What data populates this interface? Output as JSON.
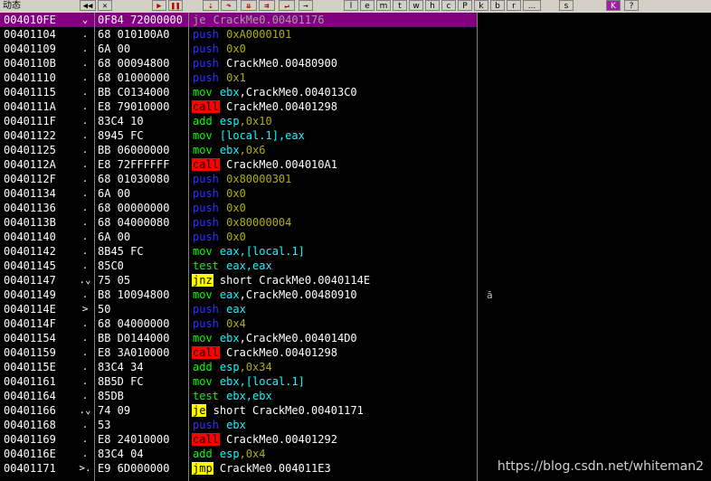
{
  "toolbar": {
    "state_label": "动态",
    "letters": [
      "l",
      "e",
      "m",
      "t",
      "w",
      "h",
      "c",
      "P",
      "k",
      "b",
      "r",
      "...",
      "s"
    ],
    "k_label": "K"
  },
  "right_marker": "ā",
  "watermark": "https://blog.csdn.net/whiteman2",
  "rows": [
    {
      "addr": "004010FE",
      "mark": "⌄",
      "hex": "0F84 72000000",
      "asm": [
        {
          "t": "mn",
          "k": "jcc",
          "v": "je"
        },
        {
          "t": "text",
          "v": " CrackMe0.00401176"
        }
      ],
      "selected": true
    },
    {
      "addr": "00401104",
      "mark": ".",
      "hex": "68 010100A0",
      "asm": [
        {
          "t": "mn",
          "k": "push",
          "v": "push"
        },
        {
          "t": "num",
          "v": " 0xA0000101"
        }
      ]
    },
    {
      "addr": "00401109",
      "mark": ".",
      "hex": "6A 00",
      "asm": [
        {
          "t": "mn",
          "k": "push",
          "v": "push"
        },
        {
          "t": "num",
          "v": " 0x0"
        }
      ]
    },
    {
      "addr": "0040110B",
      "mark": ".",
      "hex": "68 00094800",
      "asm": [
        {
          "t": "mn",
          "k": "push",
          "v": "push"
        },
        {
          "t": "text",
          "v": " CrackMe0.00480900"
        }
      ]
    },
    {
      "addr": "00401110",
      "mark": ".",
      "hex": "68 01000000",
      "asm": [
        {
          "t": "mn",
          "k": "push",
          "v": "push"
        },
        {
          "t": "num",
          "v": " 0x1"
        }
      ]
    },
    {
      "addr": "00401115",
      "mark": ".",
      "hex": "BB C0134000",
      "asm": [
        {
          "t": "mn",
          "k": "mov",
          "v": "mov"
        },
        {
          "t": "reg",
          "v": " ebx"
        },
        {
          "t": "text",
          "v": ",CrackMe0.004013C0"
        }
      ]
    },
    {
      "addr": "0040111A",
      "mark": ".",
      "hex": "E8 79010000",
      "asm": [
        {
          "t": "mn",
          "k": "call",
          "v": "call"
        },
        {
          "t": "text",
          "v": " CrackMe0.00401298"
        }
      ]
    },
    {
      "addr": "0040111F",
      "mark": ".",
      "hex": "83C4 10",
      "asm": [
        {
          "t": "mn",
          "k": "add",
          "v": "add"
        },
        {
          "t": "reg",
          "v": " esp"
        },
        {
          "t": "num",
          "v": ",0x10"
        }
      ]
    },
    {
      "addr": "00401122",
      "mark": ".",
      "hex": "8945 FC",
      "asm": [
        {
          "t": "mn",
          "k": "mov",
          "v": "mov"
        },
        {
          "t": "mem",
          "v": " [local.1]"
        },
        {
          "t": "reg",
          "v": ",eax"
        }
      ]
    },
    {
      "addr": "00401125",
      "mark": ".",
      "hex": "BB 06000000",
      "asm": [
        {
          "t": "mn",
          "k": "mov",
          "v": "mov"
        },
        {
          "t": "reg",
          "v": " ebx"
        },
        {
          "t": "num",
          "v": ",0x6"
        }
      ]
    },
    {
      "addr": "0040112A",
      "mark": ".",
      "hex": "E8 72FFFFFF",
      "asm": [
        {
          "t": "mn",
          "k": "call",
          "v": "call"
        },
        {
          "t": "text",
          "v": " CrackMe0.004010A1"
        }
      ]
    },
    {
      "addr": "0040112F",
      "mark": ".",
      "hex": "68 01030080",
      "asm": [
        {
          "t": "mn",
          "k": "push",
          "v": "push"
        },
        {
          "t": "num",
          "v": " 0x80000301"
        }
      ]
    },
    {
      "addr": "00401134",
      "mark": ".",
      "hex": "6A 00",
      "asm": [
        {
          "t": "mn",
          "k": "push",
          "v": "push"
        },
        {
          "t": "num",
          "v": " 0x0"
        }
      ]
    },
    {
      "addr": "00401136",
      "mark": ".",
      "hex": "68 00000000",
      "asm": [
        {
          "t": "mn",
          "k": "push",
          "v": "push"
        },
        {
          "t": "num",
          "v": " 0x0"
        }
      ]
    },
    {
      "addr": "0040113B",
      "mark": ".",
      "hex": "68 04000080",
      "asm": [
        {
          "t": "mn",
          "k": "push",
          "v": "push"
        },
        {
          "t": "num",
          "v": " 0x80000004"
        }
      ]
    },
    {
      "addr": "00401140",
      "mark": ".",
      "hex": "6A 00",
      "asm": [
        {
          "t": "mn",
          "k": "push",
          "v": "push"
        },
        {
          "t": "num",
          "v": " 0x0"
        }
      ]
    },
    {
      "addr": "00401142",
      "mark": ".",
      "hex": "8B45 FC",
      "asm": [
        {
          "t": "mn",
          "k": "mov",
          "v": "mov"
        },
        {
          "t": "reg",
          "v": " eax"
        },
        {
          "t": "mem",
          "v": ",[local.1]"
        }
      ]
    },
    {
      "addr": "00401145",
      "mark": ".",
      "hex": "85C0",
      "asm": [
        {
          "t": "mn",
          "k": "test",
          "v": "test"
        },
        {
          "t": "reg",
          "v": " eax,eax"
        }
      ]
    },
    {
      "addr": "00401147",
      "mark": ".⌄",
      "hex": "75 05",
      "asm": [
        {
          "t": "mn",
          "k": "jcc",
          "v": "jnz"
        },
        {
          "t": "text",
          "v": " short CrackMe0.0040114E"
        }
      ]
    },
    {
      "addr": "00401149",
      "mark": ".",
      "hex": "B8 10094800",
      "asm": [
        {
          "t": "mn",
          "k": "mov",
          "v": "mov"
        },
        {
          "t": "reg",
          "v": " eax"
        },
        {
          "t": "text",
          "v": ",CrackMe0.00480910"
        }
      ]
    },
    {
      "addr": "0040114E",
      "mark": ">",
      "hex": "50",
      "asm": [
        {
          "t": "mn",
          "k": "push",
          "v": "push"
        },
        {
          "t": "reg",
          "v": " eax"
        }
      ]
    },
    {
      "addr": "0040114F",
      "mark": ".",
      "hex": "68 04000000",
      "asm": [
        {
          "t": "mn",
          "k": "push",
          "v": "push"
        },
        {
          "t": "num",
          "v": " 0x4"
        }
      ]
    },
    {
      "addr": "00401154",
      "mark": ".",
      "hex": "BB D0144000",
      "asm": [
        {
          "t": "mn",
          "k": "mov",
          "v": "mov"
        },
        {
          "t": "reg",
          "v": " ebx"
        },
        {
          "t": "text",
          "v": ",CrackMe0.004014D0"
        }
      ]
    },
    {
      "addr": "00401159",
      "mark": ".",
      "hex": "E8 3A010000",
      "asm": [
        {
          "t": "mn",
          "k": "call",
          "v": "call"
        },
        {
          "t": "text",
          "v": " CrackMe0.00401298"
        }
      ]
    },
    {
      "addr": "0040115E",
      "mark": ".",
      "hex": "83C4 34",
      "asm": [
        {
          "t": "mn",
          "k": "add",
          "v": "add"
        },
        {
          "t": "reg",
          "v": " esp"
        },
        {
          "t": "num",
          "v": ",0x34"
        }
      ]
    },
    {
      "addr": "00401161",
      "mark": ".",
      "hex": "8B5D FC",
      "asm": [
        {
          "t": "mn",
          "k": "mov",
          "v": "mov"
        },
        {
          "t": "reg",
          "v": " ebx"
        },
        {
          "t": "mem",
          "v": ",[local.1]"
        }
      ]
    },
    {
      "addr": "00401164",
      "mark": ".",
      "hex": "85DB",
      "asm": [
        {
          "t": "mn",
          "k": "test",
          "v": "test"
        },
        {
          "t": "reg",
          "v": " ebx,ebx"
        }
      ]
    },
    {
      "addr": "00401166",
      "mark": ".⌄",
      "hex": "74 09",
      "asm": [
        {
          "t": "mn",
          "k": "jcc",
          "v": "je"
        },
        {
          "t": "text",
          "v": " short CrackMe0.00401171"
        }
      ]
    },
    {
      "addr": "00401168",
      "mark": ".",
      "hex": "53",
      "asm": [
        {
          "t": "mn",
          "k": "push",
          "v": "push"
        },
        {
          "t": "reg",
          "v": " ebx"
        }
      ]
    },
    {
      "addr": "00401169",
      "mark": ".",
      "hex": "E8 24010000",
      "asm": [
        {
          "t": "mn",
          "k": "call",
          "v": "call"
        },
        {
          "t": "text",
          "v": " CrackMe0.00401292"
        }
      ]
    },
    {
      "addr": "0040116E",
      "mark": ".",
      "hex": "83C4 04",
      "asm": [
        {
          "t": "mn",
          "k": "add",
          "v": "add"
        },
        {
          "t": "reg",
          "v": " esp"
        },
        {
          "t": "num",
          "v": ",0x4"
        }
      ]
    },
    {
      "addr": "00401171",
      "mark": ">.",
      "hex": "E9 6D000000",
      "asm": [
        {
          "t": "mn",
          "k": "jmp",
          "v": "jmp"
        },
        {
          "t": "text",
          "v": " CrackMe0.004011E3"
        }
      ]
    }
  ]
}
